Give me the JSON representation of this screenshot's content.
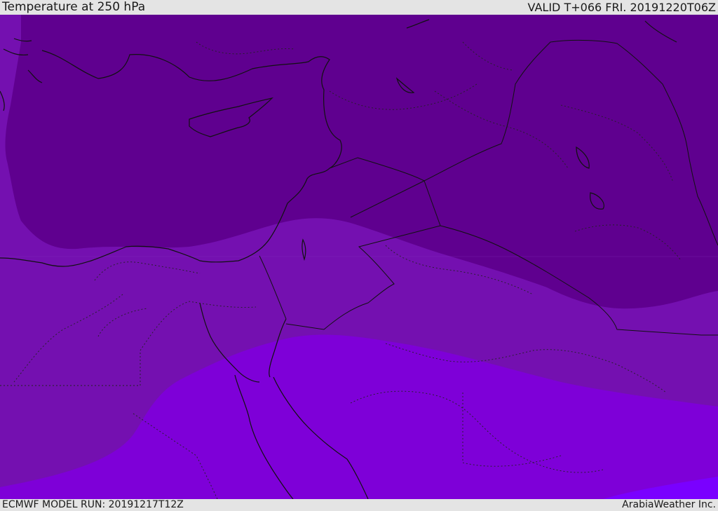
{
  "header": {
    "title": "Temperature at 250 hPa",
    "valid": "VALID T+066 FRI. 20191220T06Z"
  },
  "footer": {
    "model_run": "ECMWF MODEL RUN: 20191217T12Z",
    "credit": "ArabiaWeather Inc."
  },
  "colors": {
    "coldest": "#5f008f",
    "cold": "#7410b0",
    "mid": "#7e00d8",
    "warm": "#7a00ff",
    "lines": "#111111"
  }
}
